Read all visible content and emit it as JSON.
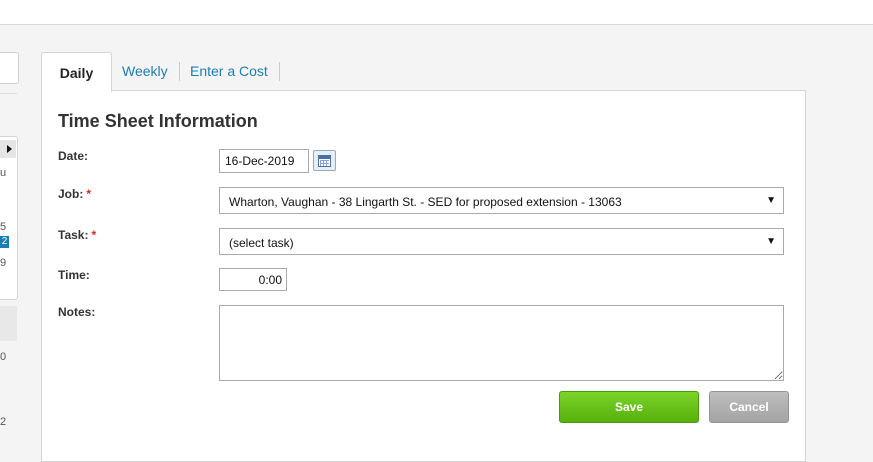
{
  "tabs": {
    "daily": "Daily",
    "weekly": "Weekly",
    "enter_cost": "Enter a Cost"
  },
  "form": {
    "title": "Time Sheet Information",
    "date_label": "Date:",
    "date_value": "16-Dec-2019",
    "job_label": "Job:",
    "job_required": "*",
    "job_value": "Wharton, Vaughan - 38 Lingarth St. - SED for proposed extension - 13063",
    "task_label": "Task:",
    "task_required": "*",
    "task_value": "(select task)",
    "time_label": "Time:",
    "time_value": "0:00",
    "notes_label": "Notes:",
    "notes_value": ""
  },
  "buttons": {
    "save": "Save",
    "cancel": "Cancel"
  },
  "sidebar_fragments": {
    "a": "u",
    "b": "5",
    "c": "2",
    "d": "9",
    "e": "0",
    "f": "2"
  },
  "icons": {
    "calendar": "calendar-icon",
    "dropdown": "chevron-down-icon"
  },
  "colors": {
    "link": "#1b7eb5",
    "required": "#d9261c",
    "save_button": "#62be14",
    "cancel_button": "#b1b1b1"
  }
}
